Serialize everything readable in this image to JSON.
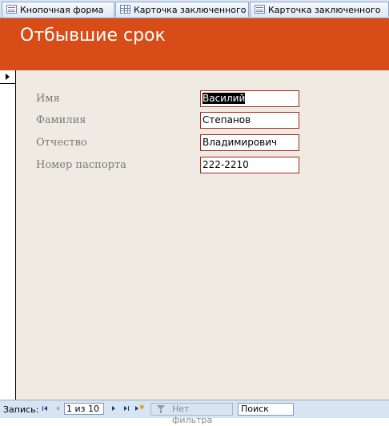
{
  "tabs": [
    {
      "label": "Кнопочная форма",
      "icon": "form-icon"
    },
    {
      "label": "Карточка заключенного",
      "icon": "table-icon"
    },
    {
      "label": "Карточка заключенного",
      "icon": "form-icon"
    }
  ],
  "form": {
    "title": "Отбывшие срок",
    "header_color": "#d84d17",
    "fields": [
      {
        "label": "Имя",
        "value": "Василий"
      },
      {
        "label": "Фамилия",
        "value": "Степанов"
      },
      {
        "label": "Отчество",
        "value": "Владимирович"
      },
      {
        "label": "Номер паспорта",
        "value": "222-2210"
      }
    ]
  },
  "navigation": {
    "record_label": "Запись:",
    "position": "1 из 10",
    "filter_label": "Нет фильтра",
    "search_placeholder": "Поиск"
  }
}
